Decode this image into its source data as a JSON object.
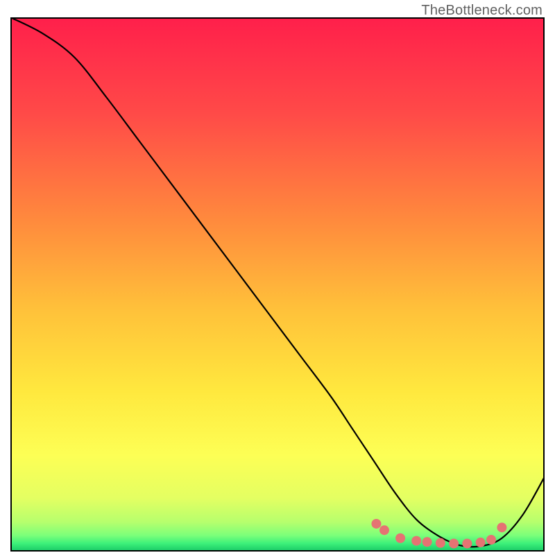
{
  "watermark": "TheBottleneck.com",
  "chart_data": {
    "type": "line",
    "title": "",
    "xlabel": "",
    "ylabel": "",
    "xlim": [
      0,
      100
    ],
    "ylim": [
      0,
      100
    ],
    "series": [
      {
        "name": "curve",
        "x": [
          0,
          6,
          12,
          18,
          24,
          30,
          36,
          42,
          48,
          54,
          60,
          64,
          68,
          72,
          76,
          80,
          84,
          88,
          92,
          96,
          100
        ],
        "y": [
          100,
          97,
          92.5,
          85,
          77,
          69,
          61,
          53,
          45,
          37,
          29,
          23,
          17,
          11,
          6,
          3,
          1.2,
          1,
          2.5,
          7,
          14
        ]
      }
    ],
    "markers": {
      "name": "optimum-cluster",
      "x": [
        68.5,
        70,
        73,
        76,
        78,
        80.5,
        83,
        85.5,
        88,
        90,
        92
      ],
      "y": [
        5.2,
        4.0,
        2.5,
        2.0,
        1.8,
        1.6,
        1.5,
        1.5,
        1.7,
        2.2,
        4.5
      ],
      "color": "#e57373",
      "radius": 7
    },
    "background_gradient": {
      "stops": [
        {
          "offset": 0.0,
          "color": "#ff1f4b"
        },
        {
          "offset": 0.18,
          "color": "#ff4a48"
        },
        {
          "offset": 0.38,
          "color": "#ff8a3d"
        },
        {
          "offset": 0.55,
          "color": "#ffc23a"
        },
        {
          "offset": 0.7,
          "color": "#ffe83e"
        },
        {
          "offset": 0.82,
          "color": "#fdff55"
        },
        {
          "offset": 0.9,
          "color": "#e4ff62"
        },
        {
          "offset": 0.945,
          "color": "#b6ff6d"
        },
        {
          "offset": 0.97,
          "color": "#7bff7a"
        },
        {
          "offset": 0.985,
          "color": "#3cf07a"
        },
        {
          "offset": 1.0,
          "color": "#17c765"
        }
      ]
    }
  }
}
